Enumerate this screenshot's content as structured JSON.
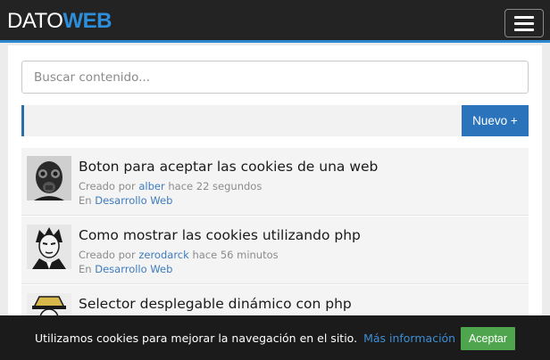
{
  "header": {
    "brand_part1": "DATO",
    "brand_part2": "WEB",
    "menu_icon": "hamburger-icon"
  },
  "search": {
    "placeholder": "Buscar contenido...",
    "value": ""
  },
  "actions": {
    "new_label": "Nuevo +"
  },
  "posts": [
    {
      "title": "Boton para aceptar las cookies de una web",
      "created_prefix": "Creado por",
      "author": "alber",
      "time": "hace 22 segundos",
      "category_prefix": "En",
      "category": "Desarrollo Web"
    },
    {
      "title": "Como mostrar las cookies utilizando php",
      "created_prefix": "Creado por",
      "author": "zerodarck",
      "time": "hace 56 minutos",
      "category_prefix": "En",
      "category": "Desarrollo Web"
    },
    {
      "title": "Selector desplegable dinámico con php"
    }
  ],
  "cookie_bar": {
    "text": "Utilizamos cookies para mejorar la navegación en el sitio.",
    "link": "Más información",
    "accept": "Aceptar"
  },
  "colors": {
    "topbar": "#232323",
    "accent_blue": "#2b87cf",
    "primary_button": "#2b74bb",
    "accept_green": "#4ea54e"
  }
}
